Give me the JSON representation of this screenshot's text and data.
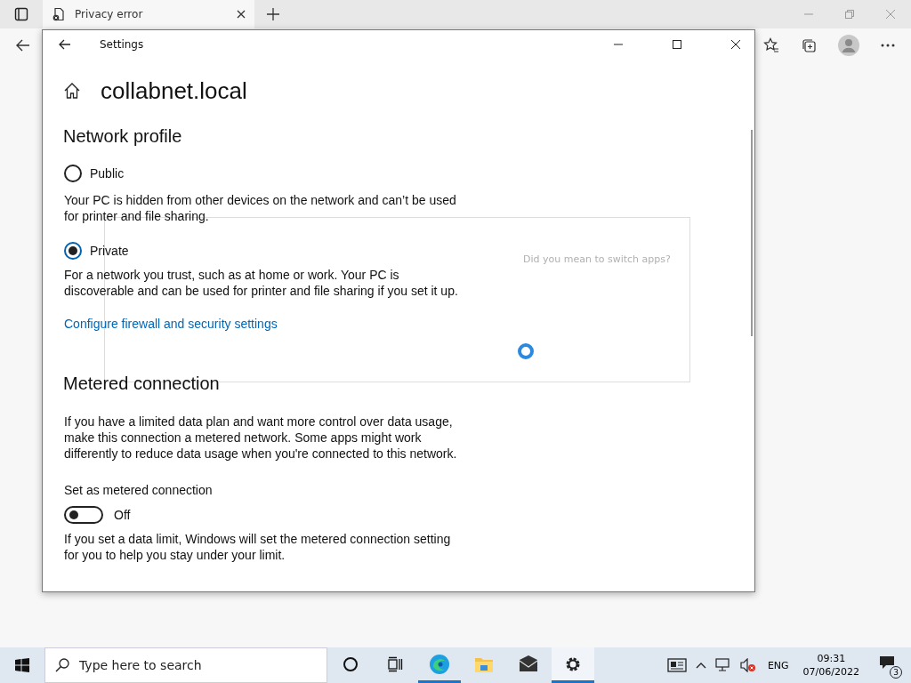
{
  "browser": {
    "tab_title": "Privacy error"
  },
  "settings_window": {
    "title": "Settings",
    "heading": "collabnet.local",
    "network_profile": {
      "title": "Network profile",
      "options": [
        {
          "label": "Public",
          "description": "Your PC is hidden from other devices on the network and can’t be used for printer and file sharing.",
          "selected": false
        },
        {
          "label": "Private",
          "description": "For a network you trust, such as at home or work. Your PC is discoverable and can be used for printer and file sharing if you set it up.",
          "selected": true
        }
      ],
      "link": "Configure firewall and security settings"
    },
    "metered_connection": {
      "title": "Metered connection",
      "description": "If you have a limited data plan and want more control over data usage, make this connection a metered network. Some apps might work differently to reduce data usage when you're connected to this network.",
      "toggle": {
        "label": "Set as metered connection",
        "on": false,
        "state_text": "Off"
      },
      "footer": "If you set a data limit, Windows will set the metered connection setting for you to help you stay under your limit."
    }
  },
  "dialog": {
    "title": "Did you mean to switch apps?"
  },
  "taskbar": {
    "search": {
      "placeholder": "Type here to search"
    },
    "apps": [
      {
        "kind": "cortana",
        "running": false,
        "selected": false
      },
      {
        "kind": "taskview",
        "running": false,
        "selected": false
      },
      {
        "kind": "edge",
        "running": true,
        "selected": false
      },
      {
        "kind": "explorer",
        "running": false,
        "selected": false
      },
      {
        "kind": "mail",
        "running": false,
        "selected": false
      },
      {
        "kind": "settings",
        "running": true,
        "selected": true
      }
    ],
    "language": "ENG",
    "time": "09:31",
    "date": "07/06/2022",
    "notifications": "3"
  }
}
